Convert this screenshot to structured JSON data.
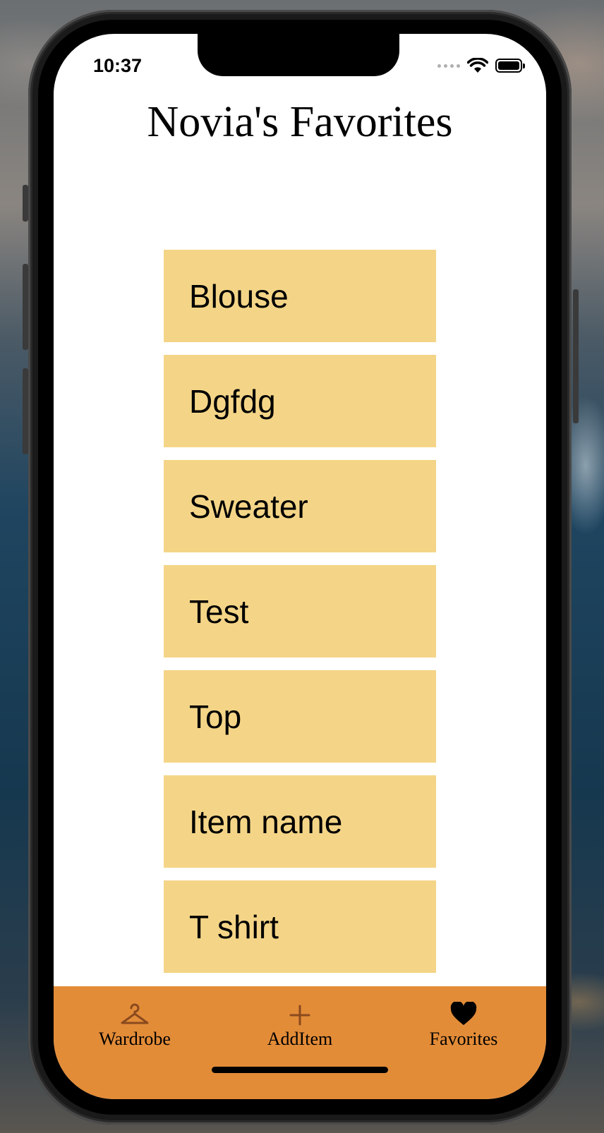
{
  "status_bar": {
    "time": "10:37"
  },
  "header": {
    "title": "Novia's Favorites"
  },
  "favorites": {
    "items": [
      {
        "label": "Blouse"
      },
      {
        "label": "Dgfdg"
      },
      {
        "label": "Sweater"
      },
      {
        "label": "Test"
      },
      {
        "label": "Top"
      },
      {
        "label": "Item name"
      },
      {
        "label": "T shirt"
      }
    ]
  },
  "tab_bar": {
    "tabs": [
      {
        "label": "Wardrobe",
        "icon": "hanger-icon"
      },
      {
        "label": "AddItem",
        "icon": "plus-icon"
      },
      {
        "label": "Favorites",
        "icon": "heart-icon"
      }
    ]
  },
  "colors": {
    "item_background": "#f4d587",
    "tab_bar_background": "#e38c38",
    "inactive_icon": "#8a4a1e",
    "active_icon": "#000000"
  }
}
